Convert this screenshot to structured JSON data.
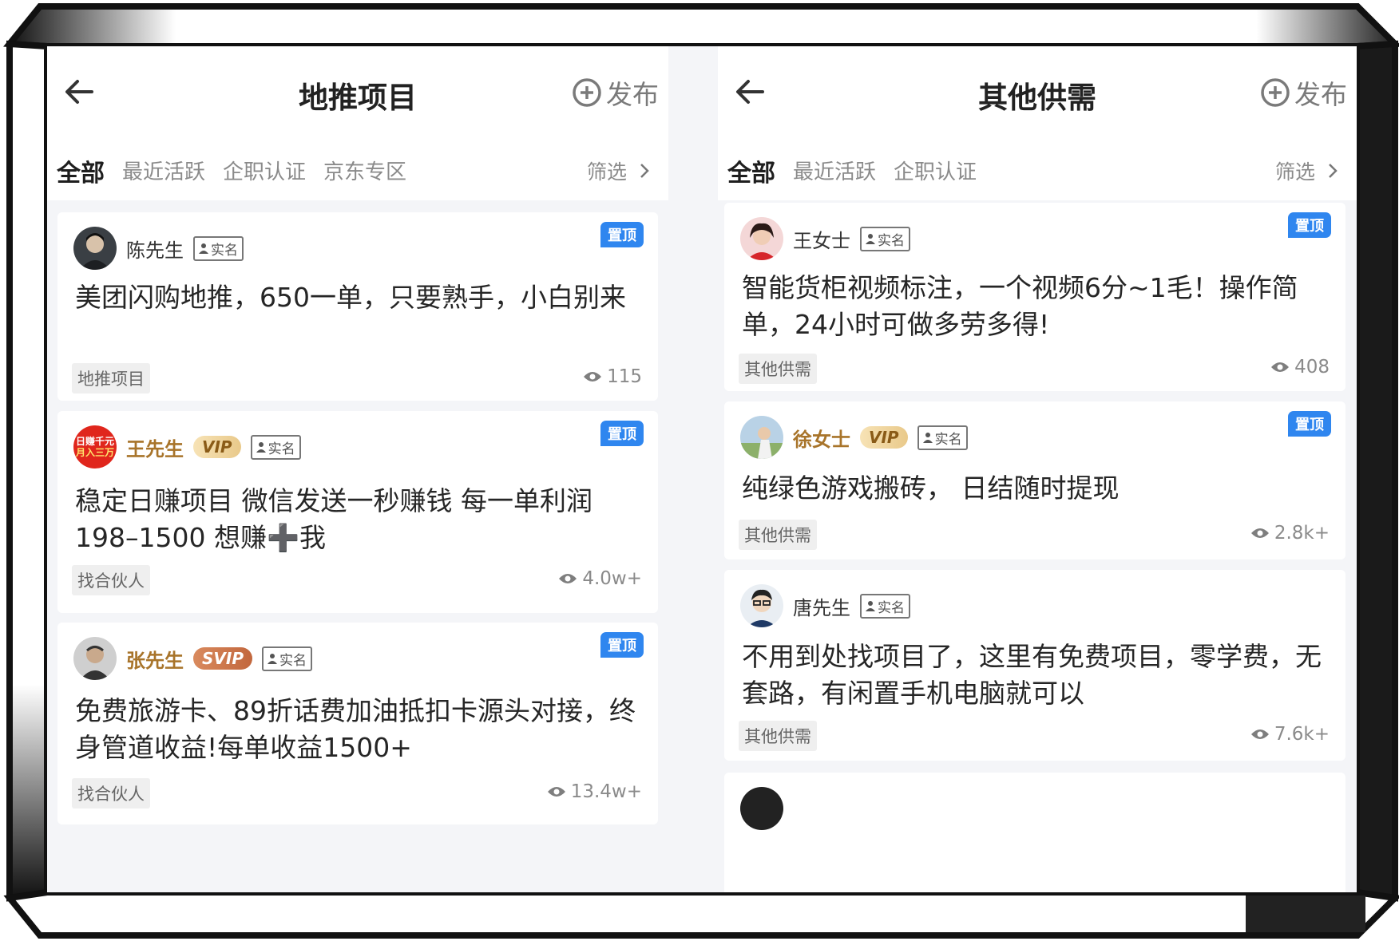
{
  "colors": {
    "accent": "#2f86ef",
    "vip_gold": "#a8742a",
    "text_main": "#262626",
    "text_muted": "#8a8a8a"
  },
  "left": {
    "title": "地推项目",
    "publish_label": "发布",
    "tabs": [
      "全部",
      "最近活跃",
      "企职认证",
      "京东专区"
    ],
    "filter_label": "筛选",
    "posts": [
      {
        "user": "陈先生",
        "badge": "",
        "real_name": "实名",
        "pin": "置顶",
        "text": "美团闪购地推，650一单，只要熟手，小白别来",
        "tag": "地推项目",
        "views": "115"
      },
      {
        "user": "王先生",
        "badge": "VIP",
        "avatar_text": "日赚千元月入三万",
        "real_name": "实名",
        "pin": "置顶",
        "text": "稳定日赚项目 微信发送一秒赚钱 每一单利润198–1500 想赚➕我",
        "tag": "找合伙人",
        "views": "4.0w+"
      },
      {
        "user": "张先生",
        "badge": "SVIP",
        "real_name": "实名",
        "pin": "置顶",
        "text": "免费旅游卡、89折话费加油抵扣卡源头对接，终身管道收益!每单收益1500+",
        "tag": "找合伙人",
        "views": "13.4w+"
      }
    ]
  },
  "right": {
    "title": "其他供需",
    "publish_label": "发布",
    "tabs": [
      "全部",
      "最近活跃",
      "企职认证"
    ],
    "filter_label": "筛选",
    "posts": [
      {
        "user": "王女士",
        "badge": "",
        "real_name": "实名",
        "pin": "置顶",
        "text": "智能货柜视频标注，一个视频6分~1毛！操作简单，24小时可做多劳多得!",
        "tag": "其他供需",
        "views": "408"
      },
      {
        "user": "徐女士",
        "badge": "VIP",
        "real_name": "实名",
        "pin": "置顶",
        "text": "纯绿色游戏搬砖， 日结随时提现",
        "tag": "其他供需",
        "views": "2.8k+"
      },
      {
        "user": "唐先生",
        "badge": "",
        "real_name": "实名",
        "pin": "",
        "text": "不用到处找项目了，这里有免费项目，零学费，无套路，有闲置手机电脑就可以",
        "tag": "其他供需",
        "views": "7.6k+"
      }
    ]
  }
}
